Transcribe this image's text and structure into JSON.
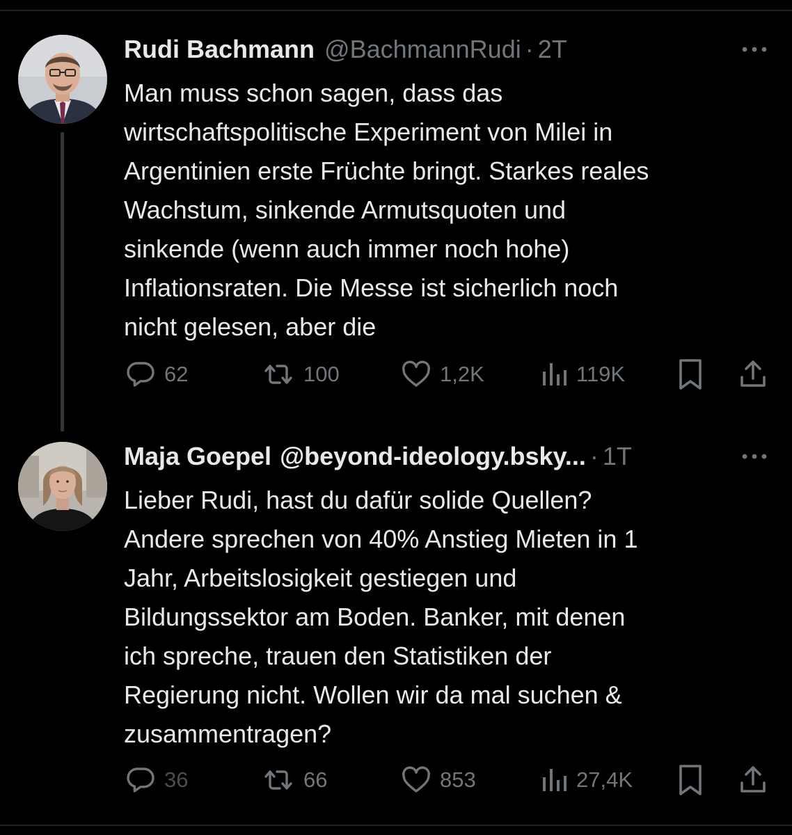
{
  "tweets": [
    {
      "display_name": "Rudi Bachmann",
      "handle": "@BachmannRudi",
      "separator": "·",
      "time": "2T",
      "text": "Man muss schon sagen, dass das\nwirtschaftspolitische Experiment von Milei in\nArgentinien erste Früchte bringt. Starkes reales\nWachstum, sinkende Armutsquoten und\nsinkende (wenn auch immer noch hohe)\nInflationsraten. Die Messe ist sicherlich noch\nnicht gelesen, aber die",
      "replies": "62",
      "reposts": "100",
      "likes": "1,2K",
      "views": "119K"
    },
    {
      "display_name": "Maja Goepel",
      "handle": "@beyond-ideology.bsky...",
      "separator": "·",
      "time": "1T",
      "text": "Lieber Rudi, hast du dafür solide Quellen?\nAndere sprechen von 40% Anstieg Mieten in 1\nJahr, Arbeitslosigkeit gestiegen und\nBildungssektor am Boden. Banker, mit denen\nich spreche, trauen den Statistiken der\nRegierung nicht. Wollen wir da mal suchen &\nzusammentragen?",
      "replies": "36",
      "reposts": "66",
      "likes": "853",
      "views": "27,4K"
    }
  ],
  "icons": {
    "reply": "speech-bubble",
    "repost": "retweet-arrows",
    "like": "heart",
    "views": "bar-chart",
    "bookmark": "bookmark",
    "share": "upload-arrow",
    "more": "three-dots"
  },
  "colors": {
    "background": "#000000",
    "text_primary": "#e7e9ea",
    "text_secondary": "#71767b",
    "thread_line": "#333639"
  }
}
